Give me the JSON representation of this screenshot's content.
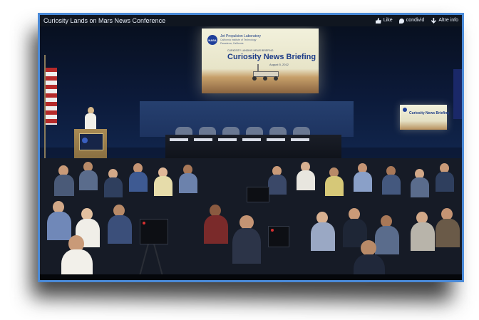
{
  "window": {
    "title": "Curiosity Lands on Mars News Conference",
    "actions": [
      {
        "label": "Like",
        "icon": "thumbs-up-icon"
      },
      {
        "label": "condivid",
        "icon": "share-icon"
      },
      {
        "label": "Altre info",
        "icon": "download-info-icon"
      }
    ]
  },
  "video": {
    "screen": {
      "logo": "NASA",
      "org_line1": "Jet Propulsion Laboratory",
      "org_line2": "California Institute of Technology",
      "org_line3": "Pasadena, California",
      "subtitle": "CURIOSITY LANDING NEWS BRIEFING",
      "heading": "Curiosity News Briefing",
      "date": "August 5, 2012"
    },
    "side_screen": {
      "heading": "Curiosity News Briefing"
    }
  },
  "colors": {
    "frame_border": "#4a8ad8",
    "title_bar": "#101620",
    "stage_blue": "#26406f"
  }
}
